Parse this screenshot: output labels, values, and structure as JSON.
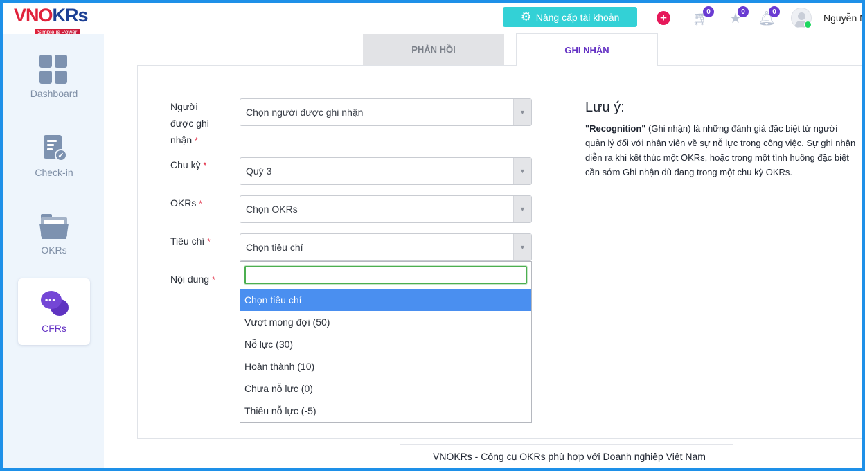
{
  "brand": {
    "logo_prefix": "VN",
    "logo_o": "O",
    "logo_suffix": "KRs",
    "tagline": "Simple is Power"
  },
  "header": {
    "upgrade_label": "Nâng cấp tài khoản",
    "cart_badge": "0",
    "star_badge": "0",
    "bell_badge": "0",
    "user_name": "Nguyễn M"
  },
  "sidebar": {
    "items": [
      {
        "label": "Dashboard",
        "icon": "dashboard-icon"
      },
      {
        "label": "Check-in",
        "icon": "checkin-icon"
      },
      {
        "label": "OKRs",
        "icon": "folder-icon"
      },
      {
        "label": "CFRs",
        "icon": "chat-bubbles-icon",
        "active": true
      }
    ]
  },
  "tabs": {
    "feedback": "PHẢN HỒI",
    "recognition": "GHI NHẬN"
  },
  "form": {
    "recipient_label_1": "Người",
    "recipient_label_2": "được ghi",
    "recipient_label_3": "nhận",
    "recipient_value": "Chọn người được ghi nhận",
    "cycle_label": "Chu kỳ",
    "cycle_value": "Quý 3",
    "okrs_label": "OKRs",
    "okrs_value": "Chọn OKRs",
    "criteria_label": "Tiêu chí",
    "criteria_value": "Chọn tiêu chí",
    "content_label": "Nội dung",
    "required_mark": "*"
  },
  "dropdown": {
    "search_value": "",
    "options": [
      "Chọn tiêu chí",
      "Vượt mong đợi (50)",
      "Nỗ lực (30)",
      "Hoàn thành (10)",
      "Chưa nỗ lực (0)",
      "Thiếu nỗ lực (-5)"
    ],
    "selected_index": 0
  },
  "note": {
    "title": "Lưu ý:",
    "bold_term": "\"Recognition\"",
    "body": " (Ghi nhận) là những đánh giá đặc biệt từ người quản lý đối với nhân viên về sự nỗ lực trong công việc. Sự ghi nhận diễn ra khi kết thúc một OKRs, hoặc trong một tình huống đặc biệt cần sớm Ghi nhận dù đang trong một chu kỳ OKRs."
  },
  "footer": {
    "text": "VNOKRs - Công cụ OKRs phù hợp với Doanh nghiệp Việt Nam"
  },
  "colors": {
    "accent": "#6533c4",
    "upgrade": "#33d1d6",
    "selected": "#4a8ff0",
    "frame": "#1e90e8"
  }
}
